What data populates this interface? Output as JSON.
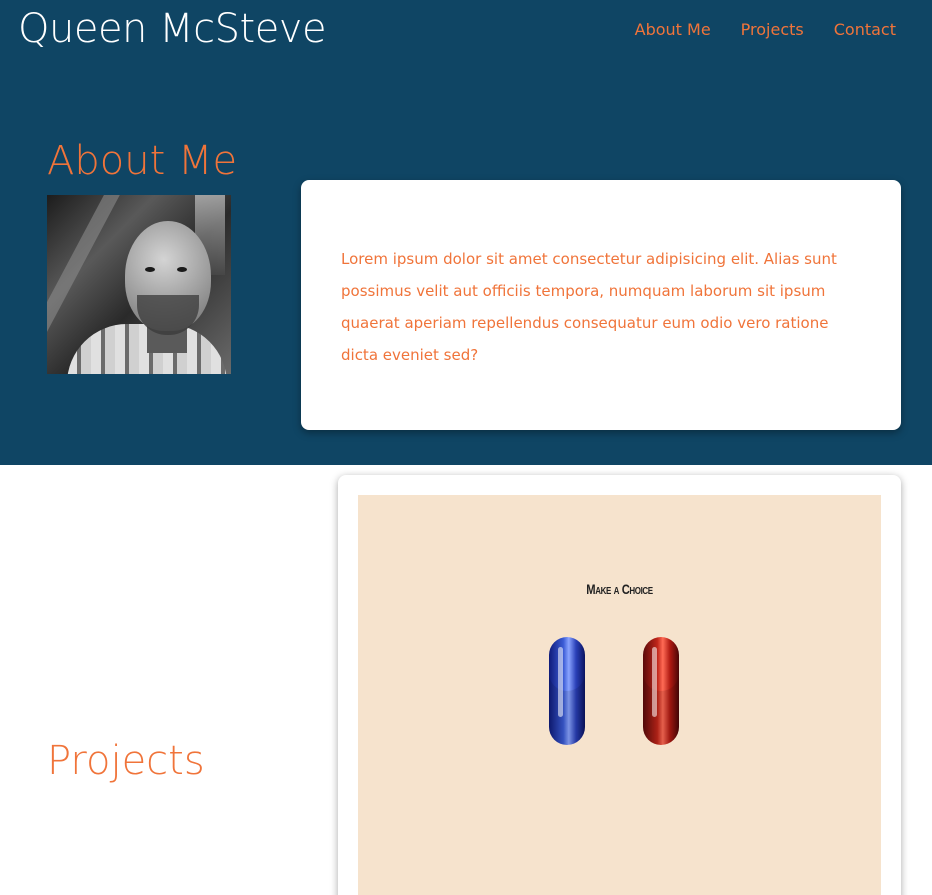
{
  "header": {
    "site_title": "Queen McSteve",
    "nav": [
      {
        "label": "About Me"
      },
      {
        "label": "Projects"
      },
      {
        "label": "Contact"
      }
    ]
  },
  "about": {
    "heading": "About Me",
    "text": "Lorem ipsum dolor sit amet consectetur adipisicing elit. Alias sunt possimus velit aut officiis tempora, numquam laborum sit ipsum quaerat aperiam repellendus consequatur eum odio vero ratione dicta eveniet sed?"
  },
  "projects": {
    "heading": "Projects",
    "items": [
      {
        "caption": "Make a Choice"
      }
    ]
  },
  "colors": {
    "header_bg": "#0f4564",
    "accent": "#f0743a",
    "project_bg": "#f6e3cd"
  }
}
